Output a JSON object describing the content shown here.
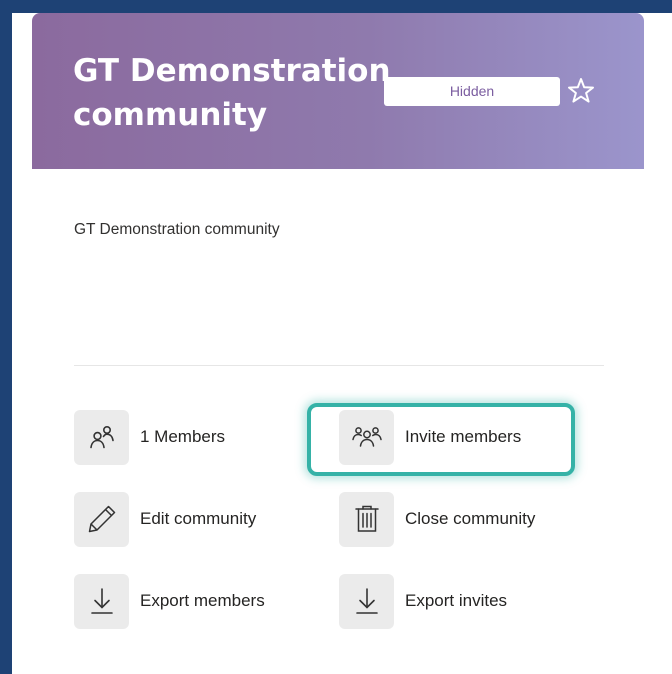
{
  "community": {
    "title": "GT Demonstration community",
    "visibility_badge": "Hidden",
    "description": "GT Demonstration community"
  },
  "actions": {
    "members": {
      "label": "1 Members",
      "icon": "people-icon"
    },
    "invite": {
      "label": "Invite members",
      "icon": "people-add-icon"
    },
    "edit": {
      "label": "Edit community",
      "icon": "pencil-icon"
    },
    "close": {
      "label": "Close community",
      "icon": "trash-icon"
    },
    "export_members": {
      "label": "Export members",
      "icon": "download-icon"
    },
    "export_invites": {
      "label": "Export invites",
      "icon": "download-icon"
    }
  },
  "colors": {
    "header_gradient_start": "#8b6a9e",
    "header_gradient_end": "#9b95cc",
    "badge_text": "#7b5da0",
    "highlight": "#35b2a7",
    "page_background": "#1e4275"
  }
}
